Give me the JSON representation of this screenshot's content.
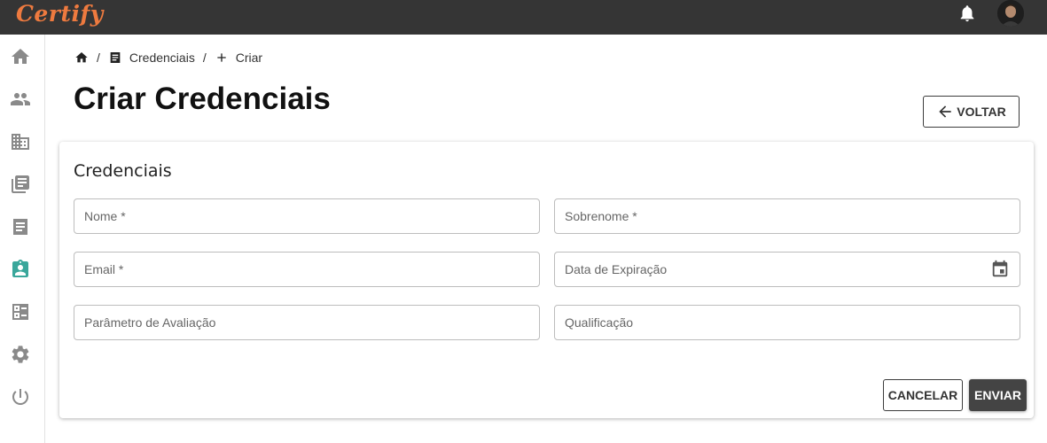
{
  "app": {
    "logo_text": "Certify"
  },
  "topbar": {
    "notification_icon": "bell-icon",
    "avatar": "user-avatar"
  },
  "sidebar": {
    "items": [
      {
        "icon": "home-icon",
        "active": false
      },
      {
        "icon": "people-icon",
        "active": false
      },
      {
        "icon": "building-icon",
        "active": false
      },
      {
        "icon": "library-books-icon",
        "active": false
      },
      {
        "icon": "receipt-icon",
        "active": false
      },
      {
        "icon": "badge-icon",
        "active": true
      },
      {
        "icon": "list-alt-icon",
        "active": false
      },
      {
        "icon": "gear-icon",
        "active": false
      },
      {
        "icon": "power-icon",
        "active": false
      }
    ],
    "icon_color": "#8a8a8a",
    "active_color": "#3aa79b"
  },
  "breadcrumb": {
    "sep1": "/",
    "credenciais": "Credenciais",
    "sep2": "/",
    "criar": "Criar"
  },
  "page": {
    "title": "Criar Credenciais",
    "back_label": "VOLTAR"
  },
  "form": {
    "title": "Credenciais",
    "fields": {
      "nome": {
        "value": "",
        "placeholder": "Nome *"
      },
      "sobrenome": {
        "value": "",
        "placeholder": "Sobrenome *"
      },
      "email": {
        "value": "",
        "placeholder": "Email *"
      },
      "data_expiracao": {
        "value": "",
        "placeholder": "Data de Expiração"
      },
      "parametro": {
        "value": "",
        "placeholder": "Parâmetro de Avaliação"
      },
      "qualificacao": {
        "value": "",
        "placeholder": "Qualificação"
      }
    },
    "cancel_label": "CANCELAR",
    "submit_label": "ENVIAR"
  },
  "colors": {
    "topbar": "#353535",
    "logo": "#ee7a3f",
    "primary_button": "#444444"
  }
}
